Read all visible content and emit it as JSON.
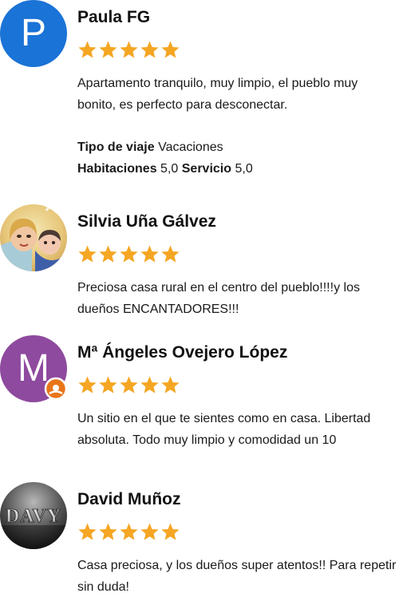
{
  "reviews": [
    {
      "name": "Paula FG",
      "avatar_letter": "P",
      "avatar_color": "#1a73d6",
      "rating": 5,
      "text": "Apartamento tranquilo, muy limpio, el pueblo muy bonito, es perfecto para desconectar.",
      "trip_type_label": "Tipo de viaje",
      "trip_type_value": "Vacaciones",
      "rooms_label": "Habitaciones",
      "rooms_value": "5,0",
      "service_label": "Servicio",
      "service_value": "5,0"
    },
    {
      "name": "Silvia Uña Gálvez",
      "avatar_type": "photo",
      "rating": 5,
      "text": "Preciosa casa rural en el centro del pueblo!!!!y los dueños ENCANTADORES!!!"
    },
    {
      "name": "Mª Ángeles Ovejero López",
      "avatar_letter": "M",
      "avatar_color": "#8e4a9e",
      "badge_color": "#e8751a",
      "rating": 5,
      "text": "Un sitio en el que te sientes como en casa. Libertad absoluta. Todo muy limpio y comodidad un 10"
    },
    {
      "name": "David Muñoz",
      "avatar_logo_text": "DAVY",
      "rating": 5,
      "text": "Casa preciosa, y los dueños super atentos!! Para repetir sin duda!"
    }
  ],
  "colors": {
    "star": "#f5a623",
    "text": "#1a1a1a"
  }
}
